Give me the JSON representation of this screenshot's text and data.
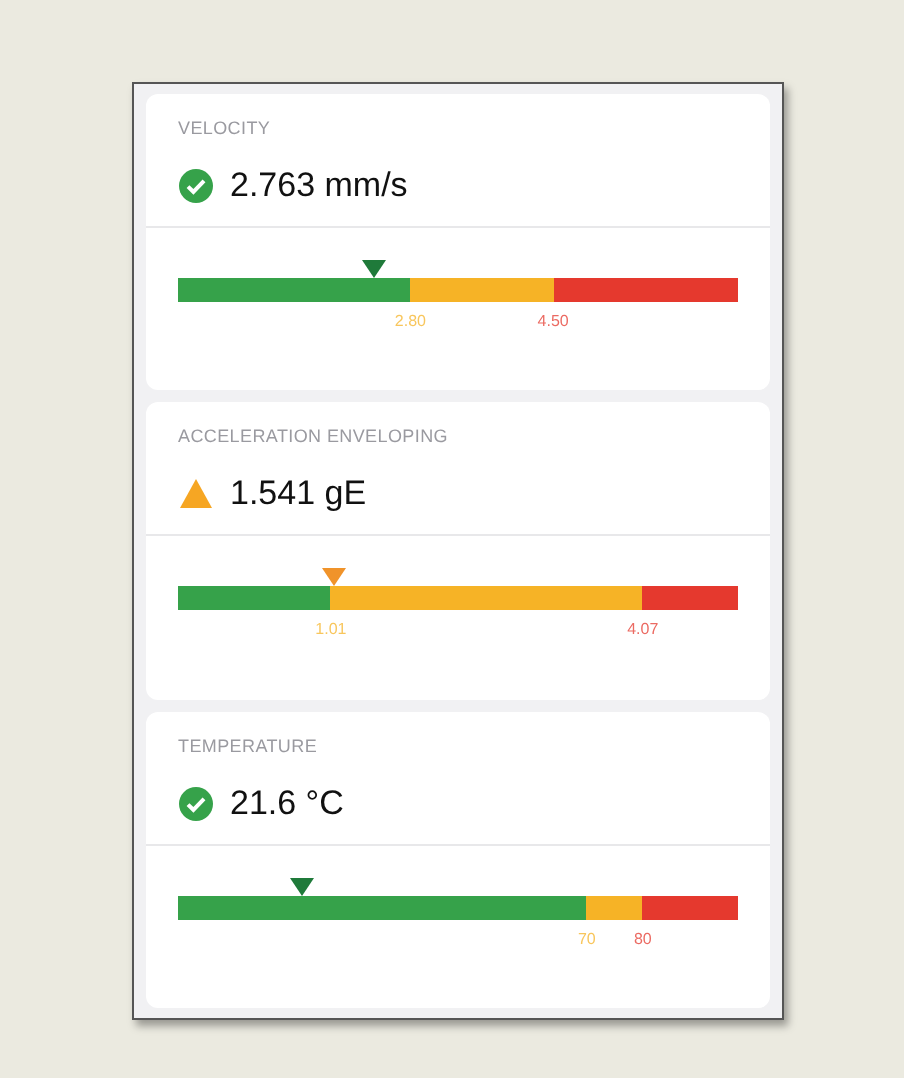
{
  "gauges": [
    {
      "title": "VELOCITY",
      "kind": "ok",
      "value": "2.763 mm/s",
      "marker": {
        "level": 0.35
      },
      "zones": [
        {
          "color": "#36a24a",
          "level": 0.415,
          "label": "2.80"
        },
        {
          "color": "#f6b326",
          "level": 0.67,
          "label": "4.50"
        },
        {
          "color": "#e5392e"
        }
      ]
    },
    {
      "title": "ACCELERATION ENVELOPING",
      "kind": "warning",
      "value": "1.541 gE",
      "marker": {
        "level": 0.28
      },
      "zones": [
        {
          "color": "#36a24a",
          "level": 0.273,
          "label": "1.01"
        },
        {
          "color": "#f6b326",
          "level": 0.83,
          "label": "4.07"
        },
        {
          "color": "#e5392e"
        }
      ]
    },
    {
      "title": "TEMPERATURE",
      "kind": "ok",
      "value": "21.6 °C",
      "marker": {
        "level": 0.22
      },
      "zones": [
        {
          "color": "#36a24a",
          "level": 0.73,
          "label": "70"
        },
        {
          "color": "#f6b326",
          "level": 0.83,
          "label": "80"
        },
        {
          "color": "#e5392e"
        }
      ]
    }
  ]
}
